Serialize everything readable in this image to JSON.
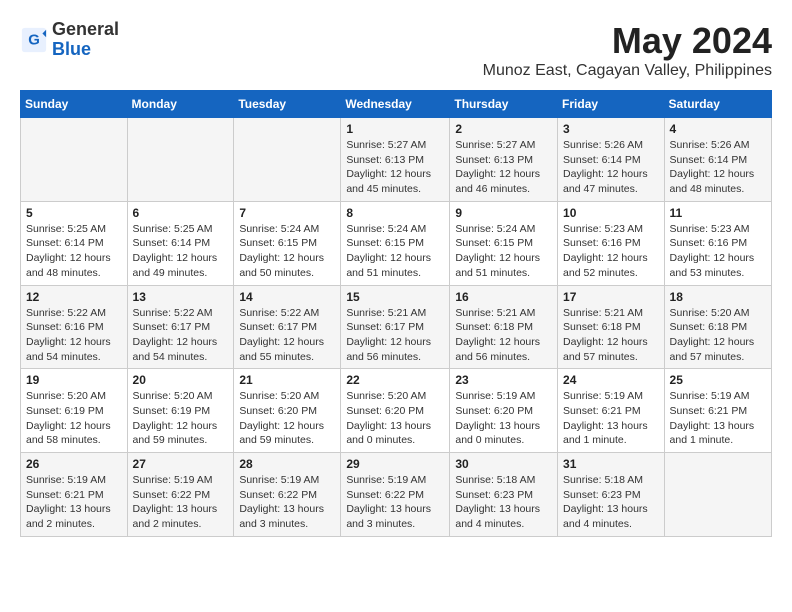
{
  "header": {
    "logo_general": "General",
    "logo_blue": "Blue",
    "month": "May 2024",
    "location": "Munoz East, Cagayan Valley, Philippines"
  },
  "weekdays": [
    "Sunday",
    "Monday",
    "Tuesday",
    "Wednesday",
    "Thursday",
    "Friday",
    "Saturday"
  ],
  "weeks": [
    [
      {
        "day": "",
        "info": ""
      },
      {
        "day": "",
        "info": ""
      },
      {
        "day": "",
        "info": ""
      },
      {
        "day": "1",
        "info": "Sunrise: 5:27 AM\nSunset: 6:13 PM\nDaylight: 12 hours\nand 45 minutes."
      },
      {
        "day": "2",
        "info": "Sunrise: 5:27 AM\nSunset: 6:13 PM\nDaylight: 12 hours\nand 46 minutes."
      },
      {
        "day": "3",
        "info": "Sunrise: 5:26 AM\nSunset: 6:14 PM\nDaylight: 12 hours\nand 47 minutes."
      },
      {
        "day": "4",
        "info": "Sunrise: 5:26 AM\nSunset: 6:14 PM\nDaylight: 12 hours\nand 48 minutes."
      }
    ],
    [
      {
        "day": "5",
        "info": "Sunrise: 5:25 AM\nSunset: 6:14 PM\nDaylight: 12 hours\nand 48 minutes."
      },
      {
        "day": "6",
        "info": "Sunrise: 5:25 AM\nSunset: 6:14 PM\nDaylight: 12 hours\nand 49 minutes."
      },
      {
        "day": "7",
        "info": "Sunrise: 5:24 AM\nSunset: 6:15 PM\nDaylight: 12 hours\nand 50 minutes."
      },
      {
        "day": "8",
        "info": "Sunrise: 5:24 AM\nSunset: 6:15 PM\nDaylight: 12 hours\nand 51 minutes."
      },
      {
        "day": "9",
        "info": "Sunrise: 5:24 AM\nSunset: 6:15 PM\nDaylight: 12 hours\nand 51 minutes."
      },
      {
        "day": "10",
        "info": "Sunrise: 5:23 AM\nSunset: 6:16 PM\nDaylight: 12 hours\nand 52 minutes."
      },
      {
        "day": "11",
        "info": "Sunrise: 5:23 AM\nSunset: 6:16 PM\nDaylight: 12 hours\nand 53 minutes."
      }
    ],
    [
      {
        "day": "12",
        "info": "Sunrise: 5:22 AM\nSunset: 6:16 PM\nDaylight: 12 hours\nand 54 minutes."
      },
      {
        "day": "13",
        "info": "Sunrise: 5:22 AM\nSunset: 6:17 PM\nDaylight: 12 hours\nand 54 minutes."
      },
      {
        "day": "14",
        "info": "Sunrise: 5:22 AM\nSunset: 6:17 PM\nDaylight: 12 hours\nand 55 minutes."
      },
      {
        "day": "15",
        "info": "Sunrise: 5:21 AM\nSunset: 6:17 PM\nDaylight: 12 hours\nand 56 minutes."
      },
      {
        "day": "16",
        "info": "Sunrise: 5:21 AM\nSunset: 6:18 PM\nDaylight: 12 hours\nand 56 minutes."
      },
      {
        "day": "17",
        "info": "Sunrise: 5:21 AM\nSunset: 6:18 PM\nDaylight: 12 hours\nand 57 minutes."
      },
      {
        "day": "18",
        "info": "Sunrise: 5:20 AM\nSunset: 6:18 PM\nDaylight: 12 hours\nand 57 minutes."
      }
    ],
    [
      {
        "day": "19",
        "info": "Sunrise: 5:20 AM\nSunset: 6:19 PM\nDaylight: 12 hours\nand 58 minutes."
      },
      {
        "day": "20",
        "info": "Sunrise: 5:20 AM\nSunset: 6:19 PM\nDaylight: 12 hours\nand 59 minutes."
      },
      {
        "day": "21",
        "info": "Sunrise: 5:20 AM\nSunset: 6:20 PM\nDaylight: 12 hours\nand 59 minutes."
      },
      {
        "day": "22",
        "info": "Sunrise: 5:20 AM\nSunset: 6:20 PM\nDaylight: 13 hours\nand 0 minutes."
      },
      {
        "day": "23",
        "info": "Sunrise: 5:19 AM\nSunset: 6:20 PM\nDaylight: 13 hours\nand 0 minutes."
      },
      {
        "day": "24",
        "info": "Sunrise: 5:19 AM\nSunset: 6:21 PM\nDaylight: 13 hours\nand 1 minute."
      },
      {
        "day": "25",
        "info": "Sunrise: 5:19 AM\nSunset: 6:21 PM\nDaylight: 13 hours\nand 1 minute."
      }
    ],
    [
      {
        "day": "26",
        "info": "Sunrise: 5:19 AM\nSunset: 6:21 PM\nDaylight: 13 hours\nand 2 minutes."
      },
      {
        "day": "27",
        "info": "Sunrise: 5:19 AM\nSunset: 6:22 PM\nDaylight: 13 hours\nand 2 minutes."
      },
      {
        "day": "28",
        "info": "Sunrise: 5:19 AM\nSunset: 6:22 PM\nDaylight: 13 hours\nand 3 minutes."
      },
      {
        "day": "29",
        "info": "Sunrise: 5:19 AM\nSunset: 6:22 PM\nDaylight: 13 hours\nand 3 minutes."
      },
      {
        "day": "30",
        "info": "Sunrise: 5:18 AM\nSunset: 6:23 PM\nDaylight: 13 hours\nand 4 minutes."
      },
      {
        "day": "31",
        "info": "Sunrise: 5:18 AM\nSunset: 6:23 PM\nDaylight: 13 hours\nand 4 minutes."
      },
      {
        "day": "",
        "info": ""
      }
    ]
  ]
}
